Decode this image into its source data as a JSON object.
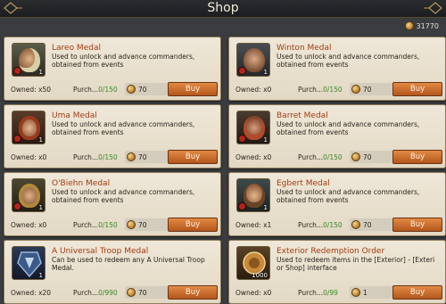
{
  "header": {
    "title": "Shop"
  },
  "currency": {
    "amount": "31770",
    "icon": "gold-coin-icon"
  },
  "items": [
    {
      "name": "Lareo Medal",
      "description": "Used to unlock and advance commanders, obtained from events",
      "owned": "Owned: x50",
      "purchase_label": "Purch...",
      "purchase_count": "0/150",
      "price": "70",
      "buy_label": "Buy",
      "quantity": "1"
    },
    {
      "name": "Winton Medal",
      "description": "Used to unlock and advance commanders, obtained from events",
      "owned": "Owned: x0",
      "purchase_label": "Purch...",
      "purchase_count": "0/150",
      "price": "70",
      "buy_label": "Buy",
      "quantity": "1"
    },
    {
      "name": "Uma Medal",
      "description": "Used to unlock and advance commanders, obtained from events",
      "owned": "Owned: x0",
      "purchase_label": "Purch...",
      "purchase_count": "0/150",
      "price": "70",
      "buy_label": "Buy",
      "quantity": "1"
    },
    {
      "name": "Barret Medal",
      "description": "Used to unlock and advance commanders, obtained from events",
      "owned": "Owned: x0",
      "purchase_label": "Purch...",
      "purchase_count": "0/150",
      "price": "70",
      "buy_label": "Buy",
      "quantity": "1"
    },
    {
      "name": "O'Biehn Medal",
      "description": "Used to unlock and advance commanders, obtained from events",
      "owned": "Owned: x0",
      "purchase_label": "Purch...",
      "purchase_count": "0/150",
      "price": "70",
      "buy_label": "Buy",
      "quantity": "1"
    },
    {
      "name": "Egbert Medal",
      "description": "Used to unlock and advance commanders, obtained from events",
      "owned": "Owned: x1",
      "purchase_label": "Purch...",
      "purchase_count": "0/150",
      "price": "70",
      "buy_label": "Buy",
      "quantity": "1"
    },
    {
      "name": "A Universal Troop Medal",
      "description": "Can be used to redeem any A Universal Troop Medal.",
      "owned": "Owned: x20",
      "purchase_label": "Purch...",
      "purchase_count": "0/990",
      "price": "70",
      "buy_label": "Buy",
      "quantity": "1"
    },
    {
      "name": "Exterior Redemption Order",
      "description": "Used to redeem items in the [Exterior] - [Exteri or Shop] interface",
      "owned": "Owned: x0",
      "purchase_label": "Purch...",
      "purchase_count": "0/99",
      "price": "1",
      "buy_label": "Buy",
      "quantity": "1000"
    }
  ]
}
